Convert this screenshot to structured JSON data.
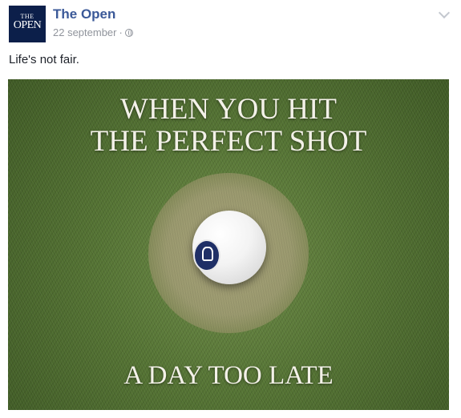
{
  "post": {
    "page_name": "The Open",
    "avatar_text": {
      "line1": "THE",
      "line2": "OPEN"
    },
    "date": "22 september",
    "separator": "·",
    "privacy_icon": "globe-icon",
    "menu_icon": "chevron-down-icon",
    "caption": "Life's not fair."
  },
  "image": {
    "line1": "WHEN YOU HIT",
    "line2": "THE PERFECT SHOT",
    "line3": "A DAY TOO LATE"
  },
  "colors": {
    "link_blue": "#3b5998",
    "meta_gray": "#90949c",
    "avatar_navy": "#0c1f4a"
  }
}
